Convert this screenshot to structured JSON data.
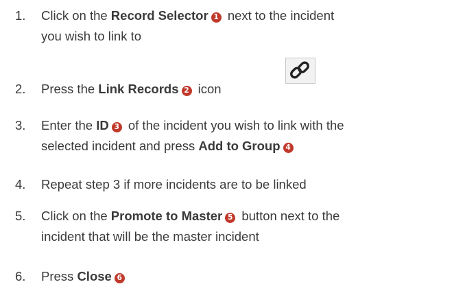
{
  "colors": {
    "text": "#3a3a3a",
    "badge": "#c0392b",
    "icon_border": "#c8c8c8",
    "icon_bg": "#f2f2f2"
  },
  "steps": [
    {
      "number": "1.",
      "before": "Click on the ",
      "bold": "Record Selector",
      "badge": "1",
      "after": " next to the incident",
      "line2": "you wish to link to"
    },
    {
      "number": "2.",
      "before": "Press the ",
      "bold": "Link Records",
      "badge": "2",
      "after": " icon",
      "icon": "link-chain-icon"
    },
    {
      "number": "3.",
      "before": "Enter the ",
      "bold": "ID",
      "badge": "3",
      "after": " of the incident you wish to link with the",
      "line2_before": "selected incident and press ",
      "line2_bold": "Add to Group",
      "line2_badge": "4"
    },
    {
      "number": "4.",
      "text": "Repeat step 3 if more incidents are to be linked"
    },
    {
      "number": "5.",
      "before": "Click on the ",
      "bold": "Promote to Master",
      "badge": "5",
      "after": " button next to the",
      "line2": "incident that will be the master incident"
    },
    {
      "number": "6.",
      "before": "Press ",
      "bold": "Close",
      "badge": "6"
    }
  ]
}
